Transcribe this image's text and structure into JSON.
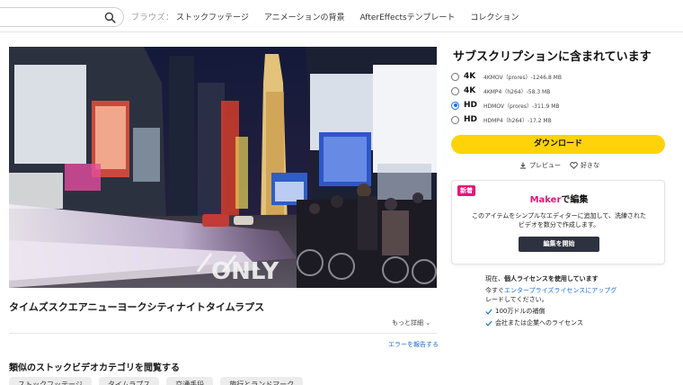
{
  "search": {
    "placeholder": ""
  },
  "header": {
    "browse_label": "ブラウズ：",
    "nav": [
      "ストックフッテージ",
      "アニメーションの背景",
      "AfterEffectsテンプレート",
      "コレクション"
    ]
  },
  "video": {
    "title": "タイムズスクエアニューヨークシティナイトタイムラプス",
    "more_label": "もっと詳細",
    "report_label": "エラーを報告する"
  },
  "categories": {
    "heading": "類似のストックビデオカテゴリを閲覧する",
    "chips": [
      "ストックフッテージ",
      "タイムラプス",
      "交通手段",
      "旅行とランドマーク"
    ]
  },
  "subscription": {
    "title": "サブスクリプションに含まれています",
    "options": [
      {
        "quality": "4K",
        "format": "4KMOV（prores）-1246.8 MB",
        "selected": false
      },
      {
        "quality": "4K",
        "format": "4KMP4（h264）-58.3 MB",
        "selected": false
      },
      {
        "quality": "HD",
        "format": "HDMOV（prores）-311.9 MB",
        "selected": true
      },
      {
        "quality": "HD",
        "format": "HDMP4（h264）-17.2 MB",
        "selected": false
      }
    ],
    "download_label": "ダウンロード",
    "preview_label": "プレビュー",
    "favorite_label": "好きな"
  },
  "maker": {
    "badge": "新着",
    "title_brand": "Maker",
    "title_rest": "で編集",
    "description": "このアイテムをシンプルなエディターに追加して、洗練されたビデオを数分で作成します。",
    "button_label": "編集を開始"
  },
  "license": {
    "current_prefix": "現在、",
    "current_type": "個人ライセンスを使用しています",
    "upgrade_prefix": "今すぐ",
    "upgrade_link": "エンタープライズライセンスにアップグ",
    "upgrade_suffix": "レードしてください。",
    "benefits": [
      "100万ドルの補償",
      "会社または企業へのライセンス"
    ]
  },
  "colors": {
    "accent_yellow": "#ffd20a",
    "maker_pink": "#e5147a",
    "link_blue": "#1f6fd1",
    "dark_button": "#2e3240"
  }
}
